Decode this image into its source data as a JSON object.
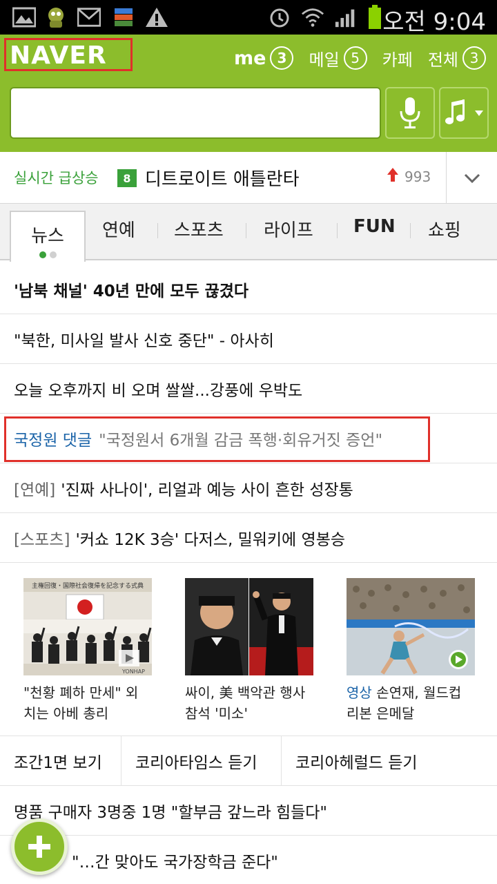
{
  "status_bar": {
    "time": "오전 9:04",
    "icons": [
      "image-icon",
      "android-icon",
      "gmail-icon",
      "app-icon",
      "warning-icon",
      "alarm-icon",
      "wifi-icon",
      "signal-icon",
      "battery-icon"
    ]
  },
  "header": {
    "logo": "NAVER",
    "nav": [
      {
        "label": "me",
        "count": "3"
      },
      {
        "label": "메일",
        "count": "5"
      },
      {
        "label": "카페"
      },
      {
        "label": "전체",
        "count": "3"
      }
    ],
    "search": {
      "placeholder": "",
      "value": ""
    }
  },
  "realtime": {
    "label": "실시간 급상승",
    "rank": "8",
    "keyword": "디트로이트 애틀란타",
    "count": "993"
  },
  "tabs": [
    "뉴스",
    "연예",
    "스포츠",
    "라이프",
    "FUN",
    "쇼핑"
  ],
  "news": [
    {
      "title": "'남북 채널' 40년 만에 모두 끊겼다"
    },
    {
      "title": "\"북한, 미사일 발사 신호 중단\" - 아사히"
    },
    {
      "title": "오늘 오후까지 비 오며 쌀쌀...강풍에 우박도"
    },
    {
      "keyword": "국정원 댓글",
      "quote": "\"국정원서 6개월 감금 폭행·회유거짓 증언\""
    },
    {
      "category": "[연예]",
      "title": "'진짜 사나이', 리얼과 예능 사이 흔한 성장통"
    },
    {
      "category": "[스포츠]",
      "title": "'커쇼 12K 3승' 다저스, 밀워키에 영봉승"
    }
  ],
  "thumbnails": [
    {
      "line1": "\"천황 폐하 만세\" 외",
      "line2": "치는 아베 총리",
      "badge": "YONHAP",
      "banner": "主権回復・国際社会復帰を記念する式典"
    },
    {
      "line1": "싸이, 美 백악관 행사",
      "line2": "참석 '미소'"
    },
    {
      "keyword": "영상",
      "line1": "손연재, 월드컵",
      "line2": "리본 은메달"
    }
  ],
  "link_buttons": [
    "조간1면 보기",
    "코리아타임스 듣기",
    "코리아헤럴드 듣기"
  ],
  "news_more": [
    "명품 구매자 3명중 1명 \"할부금 갚느라 힘들다\"",
    "\"…간 맞아도 국가장학금 준다\""
  ],
  "colors": {
    "brand_green": "#8cbd2c",
    "realtime_green": "#3aa13a",
    "link_blue": "#1a63a8",
    "highlight_red": "#e0302a"
  }
}
